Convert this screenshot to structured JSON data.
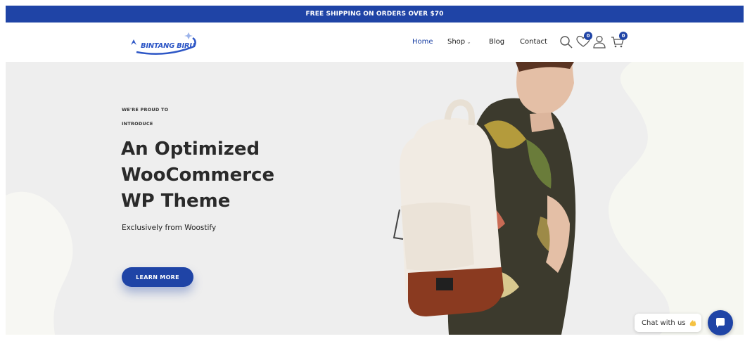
{
  "announcement": {
    "text": "FREE SHIPPING ON ORDERS OVER $70"
  },
  "header": {
    "logo_text": "BINTANG BIRU",
    "nav": {
      "home": "Home",
      "shop": "Shop",
      "blog": "Blog",
      "contact": "Contact"
    },
    "wishlist_count": "0",
    "cart_count": "0",
    "icons": [
      "search-icon",
      "heart-icon",
      "user-icon",
      "cart-icon",
      "chevron-down-icon"
    ]
  },
  "hero": {
    "kicker_line1": "WE'RE PROUD TO",
    "kicker_line2": "INTRODUCE",
    "headline_line1": "An Optimized",
    "headline_line2": "WooCommerce",
    "headline_line3": "WP Theme",
    "subtitle": "Exclusively from Woostify",
    "cta_label": "LEARN MORE"
  },
  "chat": {
    "label": "Chat with us"
  },
  "colors": {
    "brand": "#1f44a6",
    "hero_bg": "#eeeeee",
    "text_dark": "#2a2a2a"
  }
}
